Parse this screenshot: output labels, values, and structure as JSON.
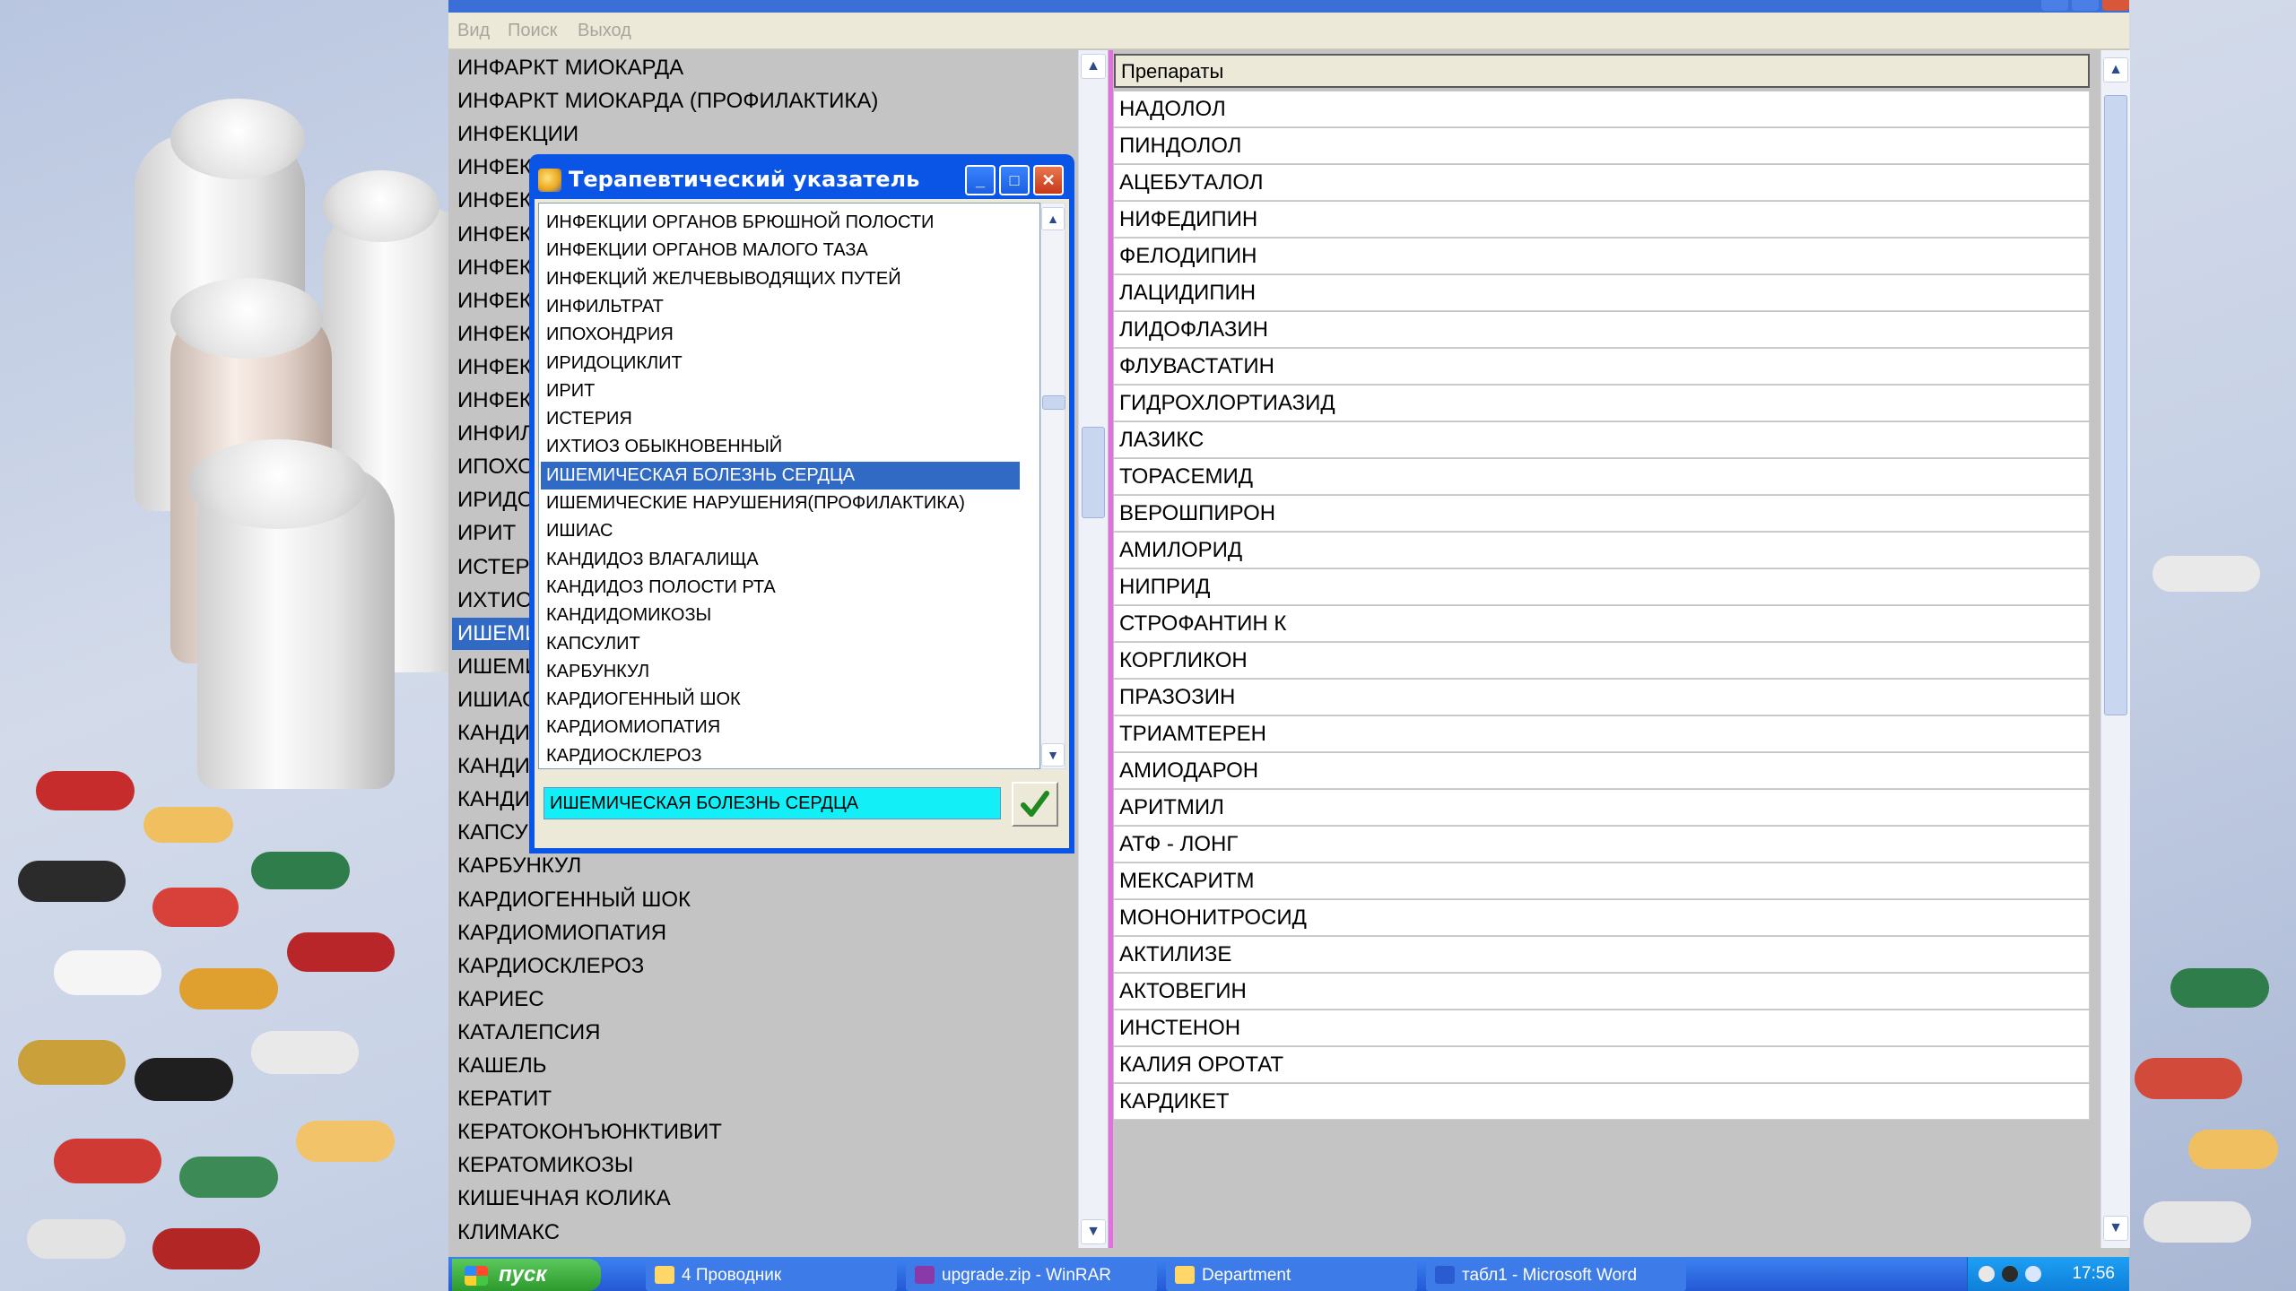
{
  "menubar": {
    "items": [
      "Вид",
      "Поиск",
      "Выход"
    ]
  },
  "left_list": {
    "items": [
      "ИНФАРКТ МИОКАРДА",
      "ИНФАРКТ МИОКАРДА (ПРОФИЛАКТИКА)",
      "ИНФЕКЦИИ",
      "ИНФЕК",
      "ИНФЕК",
      "ИНФЕК",
      "ИНФЕК",
      "ИНФЕК",
      "ИНФЕК",
      "ИНФЕК",
      "ИНФЕК",
      "ИНФИЛ",
      "ИПОХО",
      "ИРИДО",
      "ИРИТ",
      "ИСТЕР",
      "ИХТИОЗ",
      "ИШЕМИ",
      "ИШЕМИ",
      "ИШИАС",
      "КАНДИ",
      "КАНДИ",
      "КАНДИ",
      "КАПСУ",
      "КАРБУНКУЛ",
      "КАРДИОГЕННЫЙ ШОК",
      "КАРДИОМИОПАТИЯ",
      "КАРДИОСКЛЕРОЗ",
      "КАРИЕС",
      "КАТАЛЕПСИЯ",
      "КАШЕЛЬ",
      "КЕРАТИТ",
      "КЕРАТОКОНЪЮНКТИВИТ",
      "КЕРАТОМИКОЗЫ",
      "КИШЕЧНАЯ КОЛИКА",
      "КЛИМАКС"
    ],
    "selected_index": 17
  },
  "drugs_grid": {
    "header": "Препараты",
    "rows": [
      "НАДОЛОЛ",
      "ПИНДОЛОЛ",
      "АЦЕБУТАЛОЛ",
      "НИФЕДИПИН",
      "ФЕЛОДИПИН",
      "ЛАЦИДИПИН",
      "ЛИДОФЛАЗИН",
      "ФЛУВАСТАТИН",
      "ГИДРОХЛОРТИАЗИД",
      "ЛАЗИКС",
      "ТОРАСЕМИД",
      "ВЕРОШПИРОН",
      "АМИЛОРИД",
      "НИПРИД",
      "СТРОФАНТИН К",
      "КОРГЛИКОН",
      "ПРАЗОЗИН",
      "ТРИАМТЕРЕН",
      "АМИОДАРОН",
      "АРИТМИЛ",
      "АТФ - ЛОНГ",
      "МЕКСАРИТМ",
      "МОНОНИТРОСИД",
      "АКТИЛИЗЕ",
      "АКТОВЕГИН",
      "ИНСТЕНОН",
      "КАЛИЯ ОРОТАТ",
      "КАРДИКЕТ"
    ]
  },
  "dialog": {
    "title": "Терапевтический указатель",
    "items": [
      "ИНФЕКЦИИ ОРГАНОВ БРЮШНОЙ ПОЛОСТИ",
      "ИНФЕКЦИИ ОРГАНОВ МАЛОГО ТАЗА",
      "ИНФЕКЦИЙ ЖЕЛЧЕВЫВОДЯЩИХ ПУТЕЙ",
      "ИНФИЛЬТРАТ",
      "ИПОХОНДРИЯ",
      "ИРИДОЦИКЛИТ",
      "ИРИТ",
      "ИСТЕРИЯ",
      "ИХТИОЗ ОБЫКНОВЕННЫЙ",
      "ИШЕМИЧЕСКАЯ БОЛЕЗНЬ СЕРДЦА",
      "ИШЕМИЧЕСКИЕ НАРУШЕНИЯ(ПРОФИЛАКТИКА)",
      "ИШИАС",
      "КАНДИДОЗ ВЛАГАЛИЩА",
      "КАНДИДОЗ ПОЛОСТИ РТА",
      "КАНДИДОМИКОЗЫ",
      "КАПСУЛИТ",
      "КАРБУНКУЛ",
      "КАРДИОГЕННЫЙ ШОК",
      "КАРДИОМИОПАТИЯ",
      "КАРДИОСКЛЕРОЗ"
    ],
    "selected_index": 9,
    "input_value": "ИШЕМИЧЕСКАЯ БОЛЕЗНЬ СЕРДЦА"
  },
  "taskbar": {
    "start_label": "пуск",
    "tasks": [
      "4 Проводник",
      "upgrade.zip - WinRAR",
      "Department",
      "табл1 - Microsoft Word"
    ],
    "clock": "17:56"
  },
  "colors": {
    "selection": "#316ac5",
    "input_bg": "#13eff6",
    "divider": "#e36fe0",
    "dialog_frame": "#0a55e6"
  }
}
